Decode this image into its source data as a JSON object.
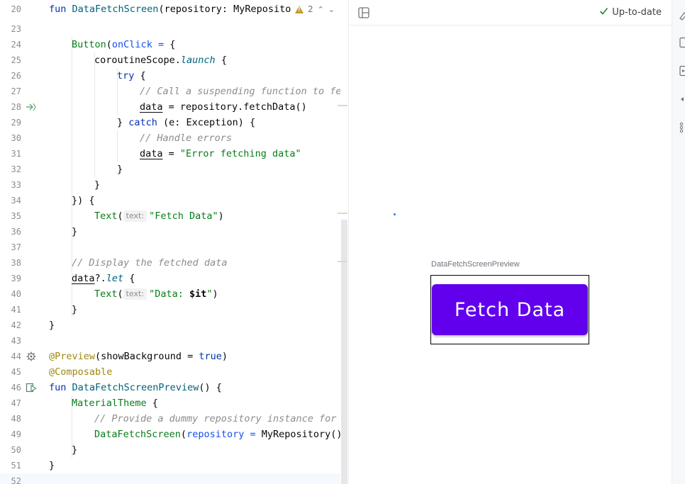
{
  "editor": {
    "warnings": {
      "count": "2"
    },
    "gutter": {
      "numbers": [
        "20",
        "23",
        "24",
        "25",
        "26",
        "27",
        "28",
        "29",
        "30",
        "31",
        "32",
        "33",
        "34",
        "35",
        "36",
        "37",
        "38",
        "39",
        "40",
        "41",
        "42",
        "43",
        "44",
        "45",
        "46",
        "47",
        "48",
        "49",
        "50",
        "51",
        "52"
      ]
    },
    "lines": {
      "l20": {
        "kw": "fun ",
        "name": "DataFetchScreen",
        "rest": "(repository: MyRepositor"
      },
      "l24": {
        "call": "Button",
        "p": "(",
        "named": "onClick = ",
        "rest": "{"
      },
      "l25": {
        "a": "coroutineScope.",
        "ital": "launch",
        "b": " {"
      },
      "l26": {
        "kw": "try",
        "rest": " {"
      },
      "l27": {
        "cm": "// Call a suspending function to fetc"
      },
      "l28": {
        "var": "data",
        "rest": " = repository.fetchData()"
      },
      "l29": {
        "a": "} ",
        "kw": "catch",
        "b": " (e: Exception) {"
      },
      "l30": {
        "cm": "// Handle errors"
      },
      "l31": {
        "var": "data",
        "eq": " = ",
        "str": "\"Error fetching data\""
      },
      "l32": {
        "t": "}"
      },
      "l33": {
        "t": "}"
      },
      "l34": {
        "t": "}) {"
      },
      "l35": {
        "call": "Text",
        "p": "(",
        "hint": "text:",
        "str": "\"Fetch Data\"",
        "close": ")"
      },
      "l36": {
        "t": "}"
      },
      "l38": {
        "cm": "// Display the fetched data"
      },
      "l39": {
        "var": "data",
        "q": "?.",
        "ital": "let",
        "b": " {"
      },
      "l40": {
        "call": "Text",
        "p": "(",
        "hint": "text:",
        "str1": "\"Data: ",
        "tmpl": "$it",
        "str2": "\"",
        "close": ")"
      },
      "l41": {
        "t": "}"
      },
      "l42": {
        "t": "}"
      },
      "l44": {
        "ann": "@Preview",
        "p": "(showBackground = ",
        "kw": "true",
        "close": ")"
      },
      "l45": {
        "ann": "@Composable"
      },
      "l46": {
        "kw": "fun ",
        "name": "DataFetchScreenPreview",
        "rest": "() {"
      },
      "l47": {
        "call": "MaterialTheme",
        "rest": " {"
      },
      "l48": {
        "cm": "// Provide a dummy repository instance for pr"
      },
      "l49": {
        "call": "DataFetchScreen",
        "p": "(",
        "named": "repository = ",
        "rest": "MyRepository())"
      },
      "l50": {
        "t": "}"
      },
      "l51": {
        "t": "}"
      }
    }
  },
  "preview": {
    "status": "Up-to-date",
    "composable_label": "DataFetchScreenPreview",
    "button_label": "Fetch Data",
    "button_color": "#6200ee"
  },
  "icons": {
    "gutter_28": "suspend-call-icon",
    "gutter_44": "preview-settings-gear-icon",
    "gutter_46": "run-preview-icon",
    "toolbar": "layout-toggle-icon",
    "status": "checkmark-icon"
  }
}
